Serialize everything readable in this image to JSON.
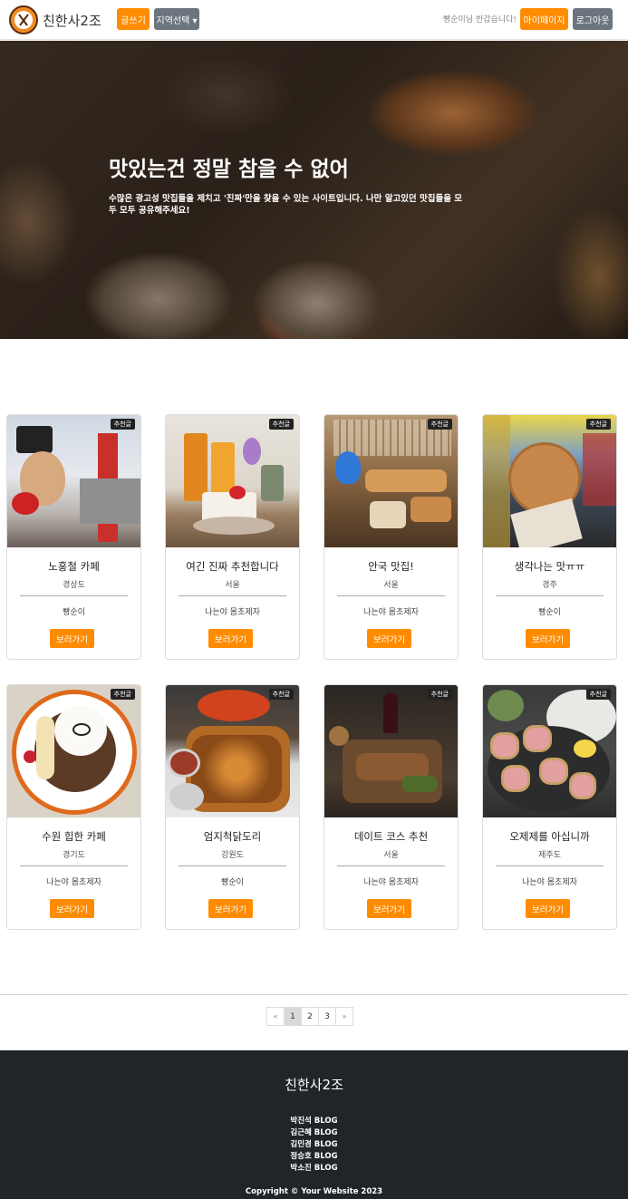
{
  "header": {
    "brand": "친한사2조",
    "write_label": "글쓰기",
    "region_label": "지역선택 ▾",
    "greeting": "빵순이님 반갑습니다!",
    "mypage_label": "마이페이지",
    "logout_label": "로그아웃"
  },
  "hero": {
    "title": "맛있는건 정말 참을 수 없어",
    "subtitle": "수많은 광고성 맛집들을 제치고 '진짜'만을 찾을 수 있는 사이트입니다. 나만 알고있던 맛집들을 모두 모두 공유해주세요!"
  },
  "badge_label": "추천글",
  "view_label": "보러가기",
  "cards": [
    {
      "title": "노홍철 카페",
      "region": "경상도",
      "author": "빵순이"
    },
    {
      "title": "여긴 진짜 추천합니다",
      "region": "서울",
      "author": "나는야 몸초제자"
    },
    {
      "title": "안국 맛집!",
      "region": "서울",
      "author": "나는야 몸초제자"
    },
    {
      "title": "생각나는 맛ㅠㅠ",
      "region": "경주",
      "author": "빵순이"
    },
    {
      "title": "수원 힙한 카페",
      "region": "경기도",
      "author": "나는야 몸초제자"
    },
    {
      "title": "엄지척닭도리",
      "region": "강원도",
      "author": "빵순이"
    },
    {
      "title": "데이트 코스 추천",
      "region": "서울",
      "author": "나는야 몸초제자"
    },
    {
      "title": "오제제를 아십니까",
      "region": "제주도",
      "author": "나는야 몸초제자"
    }
  ],
  "pagination": {
    "prev": "«",
    "pages": [
      "1",
      "2",
      "3"
    ],
    "next": "»",
    "active": "1"
  },
  "footer": {
    "title": "친한사2조",
    "links": [
      "박진석 BLOG",
      "김근혜 BLOG",
      "김민경 BLOG",
      "정승호 BLOG",
      "박소진 BLOG"
    ],
    "copyright": "Copyright © Your Website 2023"
  },
  "colors": {
    "accent": "#ff8c00",
    "secondary": "#6c757d",
    "footer_bg": "#212529"
  }
}
